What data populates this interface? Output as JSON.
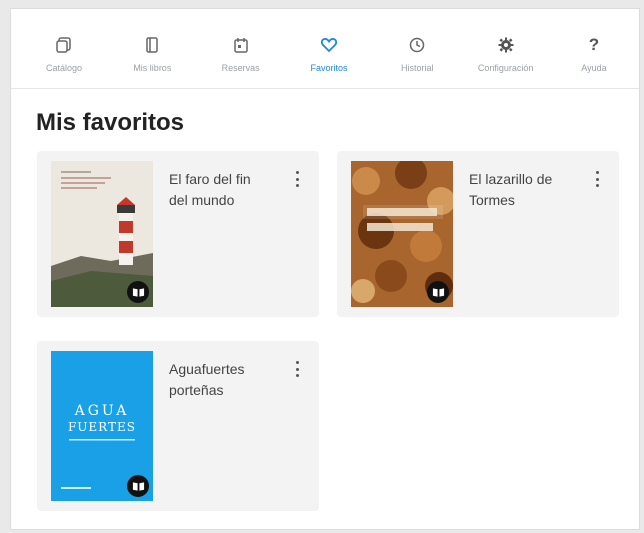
{
  "nav": {
    "items": [
      {
        "label": "Catálogo",
        "icon": "catalog-icon"
      },
      {
        "label": "Mis libros",
        "icon": "book-icon"
      },
      {
        "label": "Reservas",
        "icon": "calendar-icon"
      },
      {
        "label": "Favoritos",
        "icon": "heart-icon"
      },
      {
        "label": "Historial",
        "icon": "history-icon"
      },
      {
        "label": "Configuración",
        "icon": "gear-icon"
      },
      {
        "label": "Ayuda",
        "icon": "help-icon"
      }
    ],
    "active_index": 3,
    "help_glyph": "?",
    "active_color": "#1e88e5"
  },
  "page": {
    "title": "Mis favoritos"
  },
  "favorites": [
    {
      "title": "El faro del fin del mundo",
      "cover": "lighthouse-cover",
      "badge_icon": "open-book-icon"
    },
    {
      "title": "El lazarillo de Tormes",
      "cover": "lazarillo-cover",
      "badge_icon": "open-book-icon"
    },
    {
      "title": "Aguafuertes porteñas",
      "cover": "aguafuertes-cover",
      "badge_icon": "open-book-icon",
      "cover_text": {
        "line1": "AGUA",
        "line2": "FUERTES"
      }
    }
  ]
}
